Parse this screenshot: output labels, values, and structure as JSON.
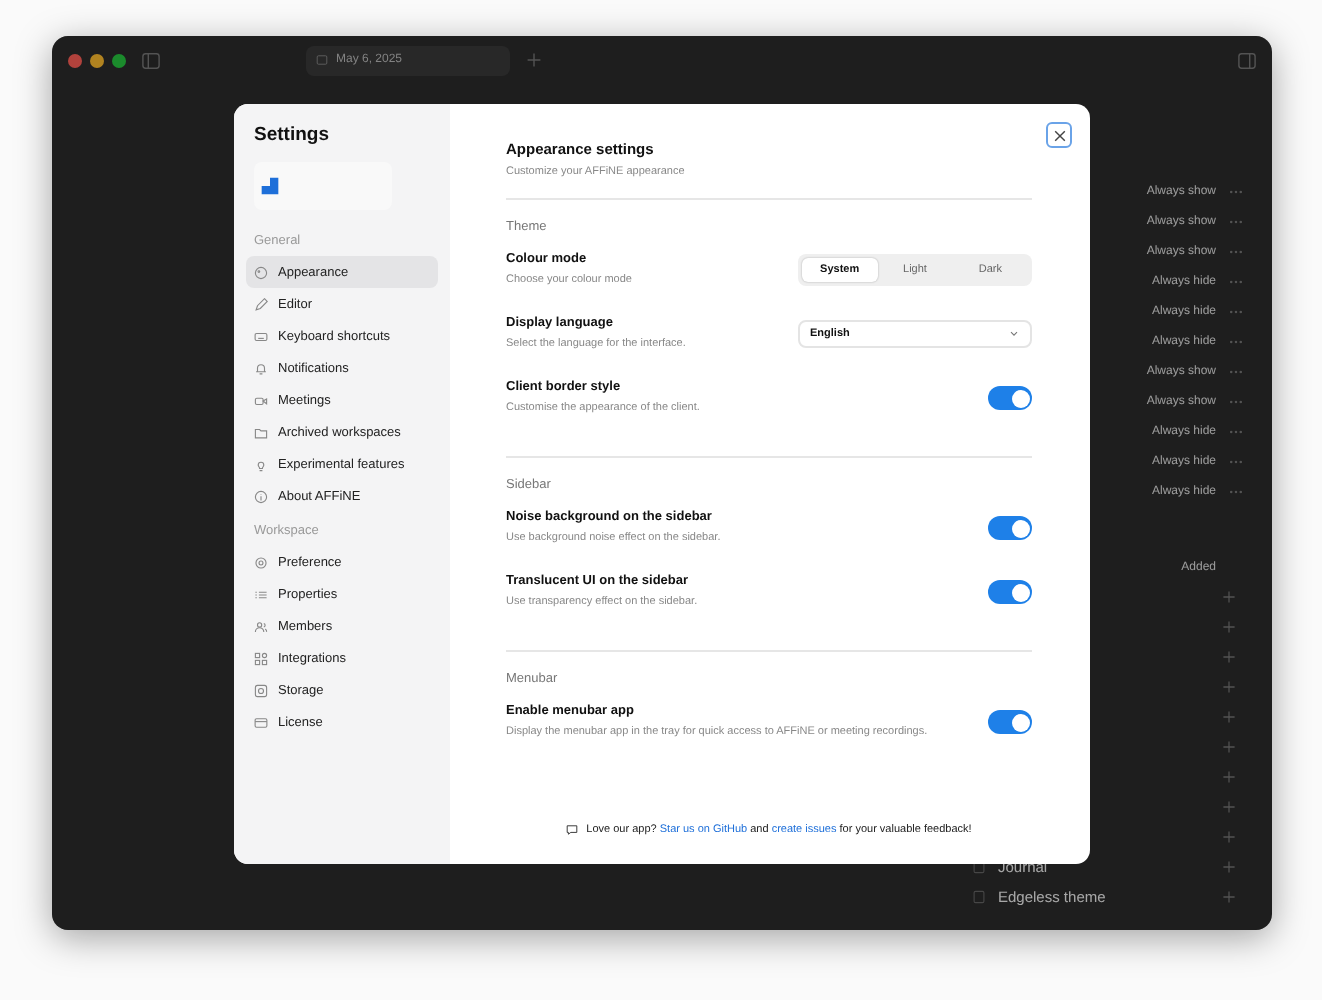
{
  "window": {
    "tab_title": "May 6, 2025"
  },
  "background_panel": {
    "rows": [
      {
        "label": "Always show"
      },
      {
        "label": "Always show"
      },
      {
        "label": "Always show"
      },
      {
        "label": "Always hide"
      },
      {
        "label": "Always hide"
      },
      {
        "label": "Always hide"
      },
      {
        "label": "Always show"
      },
      {
        "label": "Always show"
      },
      {
        "label": "Always hide"
      },
      {
        "label": "Always hide"
      },
      {
        "label": "Always hide"
      }
    ],
    "added_label": "Added",
    "add_rows": [
      {},
      {},
      {},
      {},
      {},
      {},
      {},
      {},
      {},
      {
        "label": "Journal"
      },
      {
        "label": "Edgeless theme"
      }
    ]
  },
  "settings": {
    "title": "Settings",
    "groups": [
      {
        "heading": "General",
        "items": [
          {
            "label": "Appearance",
            "selected": true
          },
          {
            "label": "Editor",
            "selected": false
          },
          {
            "label": "Keyboard shortcuts",
            "selected": false
          },
          {
            "label": "Notifications",
            "selected": false
          },
          {
            "label": "Meetings",
            "selected": false
          },
          {
            "label": "Archived workspaces",
            "selected": false
          },
          {
            "label": "Experimental features",
            "selected": false
          },
          {
            "label": "About AFFiNE",
            "selected": false
          }
        ]
      },
      {
        "heading": "Workspace",
        "items": [
          {
            "label": "Preference",
            "selected": false
          },
          {
            "label": "Properties",
            "selected": false
          },
          {
            "label": "Members",
            "selected": false
          },
          {
            "label": "Integrations",
            "selected": false
          },
          {
            "label": "Storage",
            "selected": false
          },
          {
            "label": "License",
            "selected": false
          }
        ]
      }
    ],
    "page_title": "Appearance settings",
    "page_subtitle": "Customize your AFFiNE appearance",
    "sections": [
      {
        "heading": "Theme",
        "rows": [
          {
            "kind": "segmented",
            "title": "Colour mode",
            "description": "Choose your colour mode",
            "options": [
              {
                "label": "System",
                "selected": true
              },
              {
                "label": "Light",
                "selected": false
              },
              {
                "label": "Dark",
                "selected": false
              }
            ]
          },
          {
            "kind": "select",
            "title": "Display language",
            "description": "Select the language for the interface.",
            "value": "English"
          },
          {
            "kind": "toggle",
            "title": "Client border style",
            "description": "Customise the appearance of the client.",
            "on": true
          }
        ]
      },
      {
        "heading": "Sidebar",
        "rows": [
          {
            "kind": "toggle",
            "title": "Noise background on the sidebar",
            "description": "Use background noise effect on the sidebar.",
            "on": true
          },
          {
            "kind": "toggle",
            "title": "Translucent UI on the sidebar",
            "description": "Use transparency effect on the sidebar.",
            "on": true
          }
        ]
      },
      {
        "heading": "Menubar",
        "rows": [
          {
            "kind": "toggle",
            "title": "Enable menubar app",
            "description": "Display the menubar app in the tray for quick access to AFFiNE or meeting recordings.",
            "on": true
          }
        ]
      }
    ],
    "footer": {
      "before": "Love our app?",
      "link_1": "Star us on GitHub",
      "middle": "and",
      "link_2": "create issues",
      "after": "for your valuable feedback!"
    }
  }
}
